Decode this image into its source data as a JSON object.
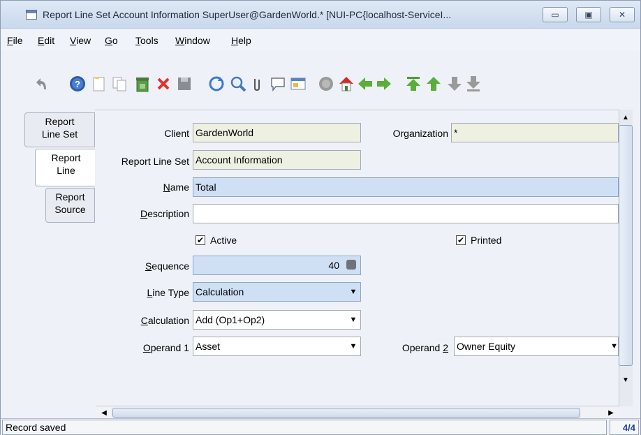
{
  "window": {
    "title": "Report Line Set  Account Information  SuperUser@GardenWorld.* [NUI-PC{localhost-ServiceI...",
    "buttons": {
      "minimize": "▭",
      "maximize": "▣",
      "close": "✕"
    }
  },
  "menu": [
    {
      "label": "File",
      "underline": "F",
      "rest": "ile"
    },
    {
      "label": "Edit",
      "underline": "E",
      "rest": "dit"
    },
    {
      "label": "View",
      "underline": "V",
      "rest": "iew"
    },
    {
      "label": "Go",
      "underline": "G",
      "rest": "o"
    },
    {
      "label": "Tools",
      "underline": "T",
      "rest": "ools"
    },
    {
      "label": "Window",
      "underline": "W",
      "rest": "indow"
    },
    {
      "label": "Help",
      "underline": "H",
      "rest": "elp"
    }
  ],
  "toolbar": {
    "icons": [
      "undo-icon",
      "help-icon",
      "new-record-icon",
      "copy-record-icon",
      "delete-record-icon",
      "delete-selection-icon",
      "save-icon",
      "refresh-icon",
      "find-icon",
      "attachment-icon",
      "chat-icon",
      "grid-toggle-icon",
      "history-icon",
      "home-icon",
      "previous-icon",
      "next-icon",
      "first-record-icon",
      "previous-record-icon",
      "next-record-icon",
      "last-record-icon"
    ]
  },
  "tabs": [
    {
      "line1": "Report",
      "line2": "Line Set"
    },
    {
      "line1": "Report",
      "line2": "Line"
    },
    {
      "line1": "Report",
      "line2": "Source"
    }
  ],
  "form": {
    "client": {
      "label": "Client",
      "value": "GardenWorld"
    },
    "organization": {
      "label": "Organization",
      "value": "*"
    },
    "report_line_set": {
      "label": "Report Line Set",
      "value": "Account Information"
    },
    "name": {
      "label_u": "N",
      "label_rest": "ame",
      "value": "Total"
    },
    "description": {
      "label_u": "D",
      "label_rest": "escription",
      "value": ""
    },
    "active": {
      "label": "Active",
      "checked": "✔"
    },
    "printed": {
      "label": "Printed",
      "checked": "✔"
    },
    "sequence": {
      "label_u": "S",
      "label_rest": "equence",
      "value": "40"
    },
    "line_type": {
      "label_u": "L",
      "label_rest": "ine Type",
      "value": "Calculation"
    },
    "calculation": {
      "label_u": "C",
      "label_rest": "alculation",
      "value": "Add (Op1+Op2)"
    },
    "operand1": {
      "label_pre": "",
      "label_u": "O",
      "label_rest": "perand 1",
      "value": "Asset"
    },
    "operand2": {
      "label_pre": "Operand ",
      "label_u": "2",
      "label_rest": "",
      "value": "Owner Equity"
    }
  },
  "status": {
    "message": "Record saved",
    "count": "4/4"
  },
  "colors": {
    "mandatory_field": "#cfe0f5",
    "readonly_field": "#eef0e2",
    "accent": "#1a3f9a"
  }
}
